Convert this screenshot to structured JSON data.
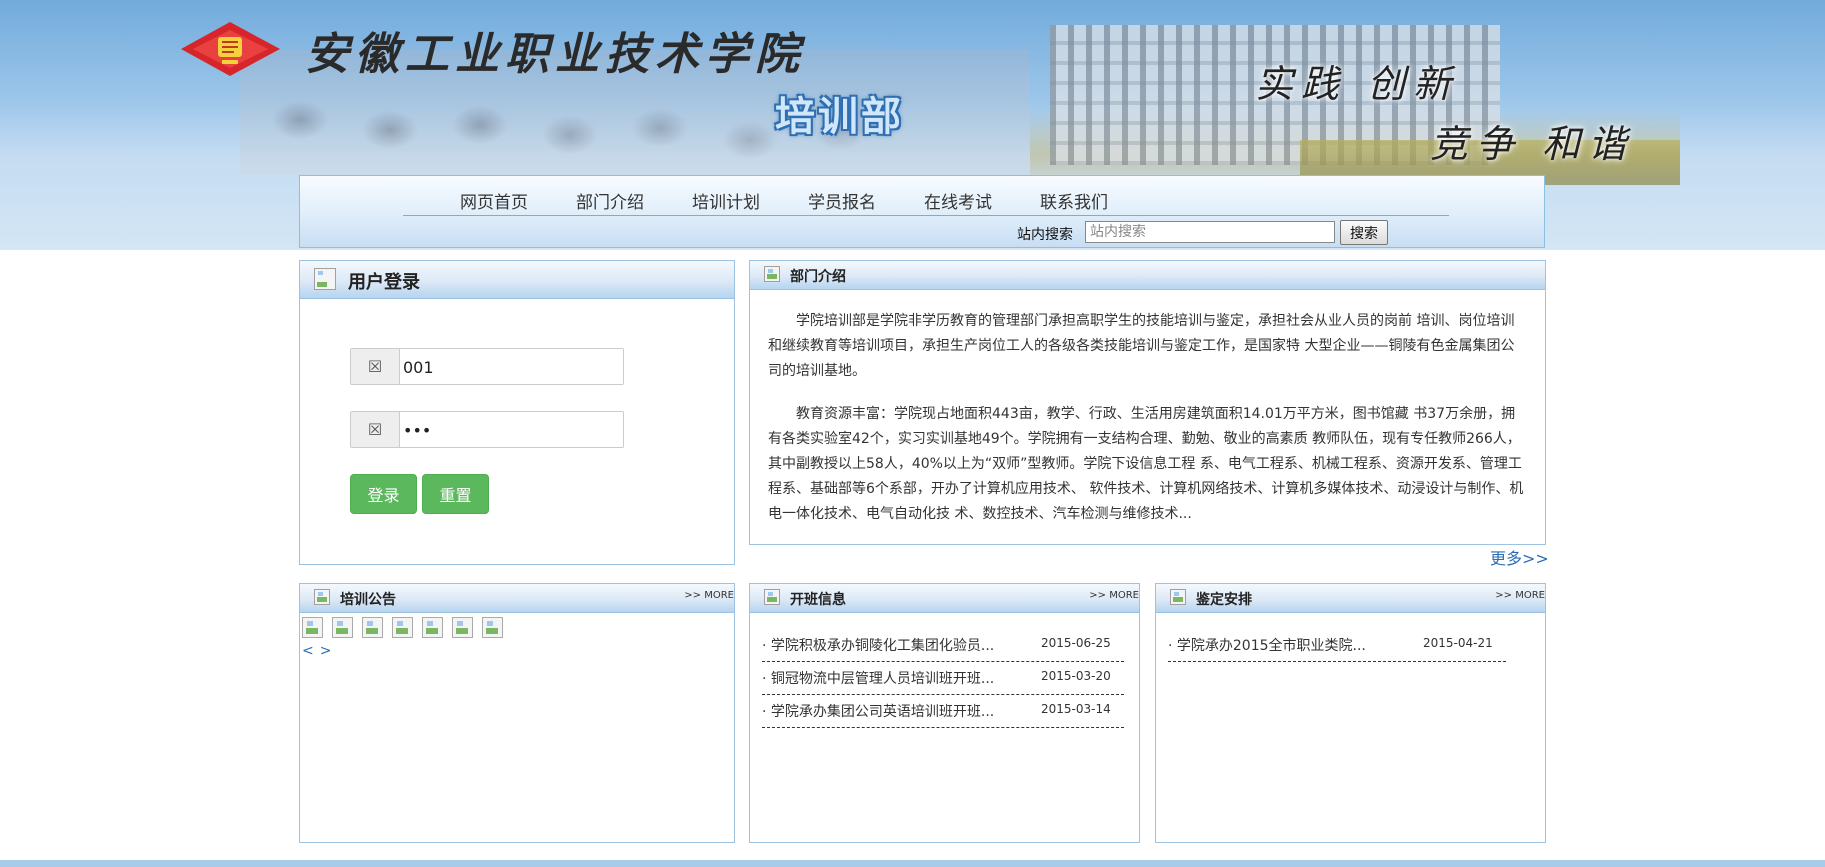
{
  "banner": {
    "school_name": "安徽工业职业技术学院",
    "dept_name": "培训部",
    "slogan_line1": "实践 创新",
    "slogan_line2": "竞争 和谐"
  },
  "nav": {
    "items": [
      "网页首页",
      "部门介绍",
      "培训计划",
      "学员报名",
      "在线考试",
      "联系我们"
    ],
    "search_label": "站内搜索",
    "search_placeholder": "站内搜索",
    "search_button": "搜索"
  },
  "login": {
    "title": "用户登录",
    "username_icon": "☒",
    "username_value": "001",
    "password_icon": "☒",
    "password_value": "•••",
    "login_button": "登录",
    "reset_button": "重置"
  },
  "intro": {
    "title": "部门介绍",
    "para1": "学院培训部是学院非学历教育的管理部门承担高职学生的技能培训与鉴定，承担社会从业人员的岗前 培训、岗位培训和继续教育等培训项目，承担生产岗位工人的各级各类技能培训与鉴定工作，是国家特 大型企业——铜陵有色金属集团公司的培训基地。",
    "para2": "教育资源丰富：学院现占地面积443亩，教学、行政、生活用房建筑面积14.01万平方米，图书馆藏 书37万余册，拥有各类实验室42个，实习实训基地49个。学院拥有一支结构合理、勤勉、敬业的高素质 教师队伍，现有专任教师266人，其中副教授以上58人，40%以上为“双师”型教师。学院下设信息工程 系、电气工程系、机械工程系、资源开发系、管理工程系、基础部等6个系部，开办了计算机应用技术、 软件技术、计算机网络技术、计算机多媒体技术、动浸设计与制作、机电一体化技术、电气自动化技 术、数控技术、汽车检测与维修技术...",
    "more": "更多>>"
  },
  "notice": {
    "title": "培训公告",
    "more": ">> MORE",
    "pager_prev": "<",
    "pager_next": ">"
  },
  "classes": {
    "title": "开班信息",
    "more": ">> MORE",
    "items": [
      {
        "title": "· 学院积极承办铜陵化工集团化验员...",
        "date": "2015-06-25"
      },
      {
        "title": "· 铜冠物流中层管理人员培训班开班...",
        "date": "2015-03-20"
      },
      {
        "title": "· 学院承办集团公司英语培训班开班...",
        "date": "2015-03-14"
      }
    ]
  },
  "arrange": {
    "title": "鉴定安排",
    "more": ">> MORE",
    "items": [
      {
        "title": "· 学院承办2015全市职业类院...",
        "date": "2015-04-21"
      }
    ]
  }
}
